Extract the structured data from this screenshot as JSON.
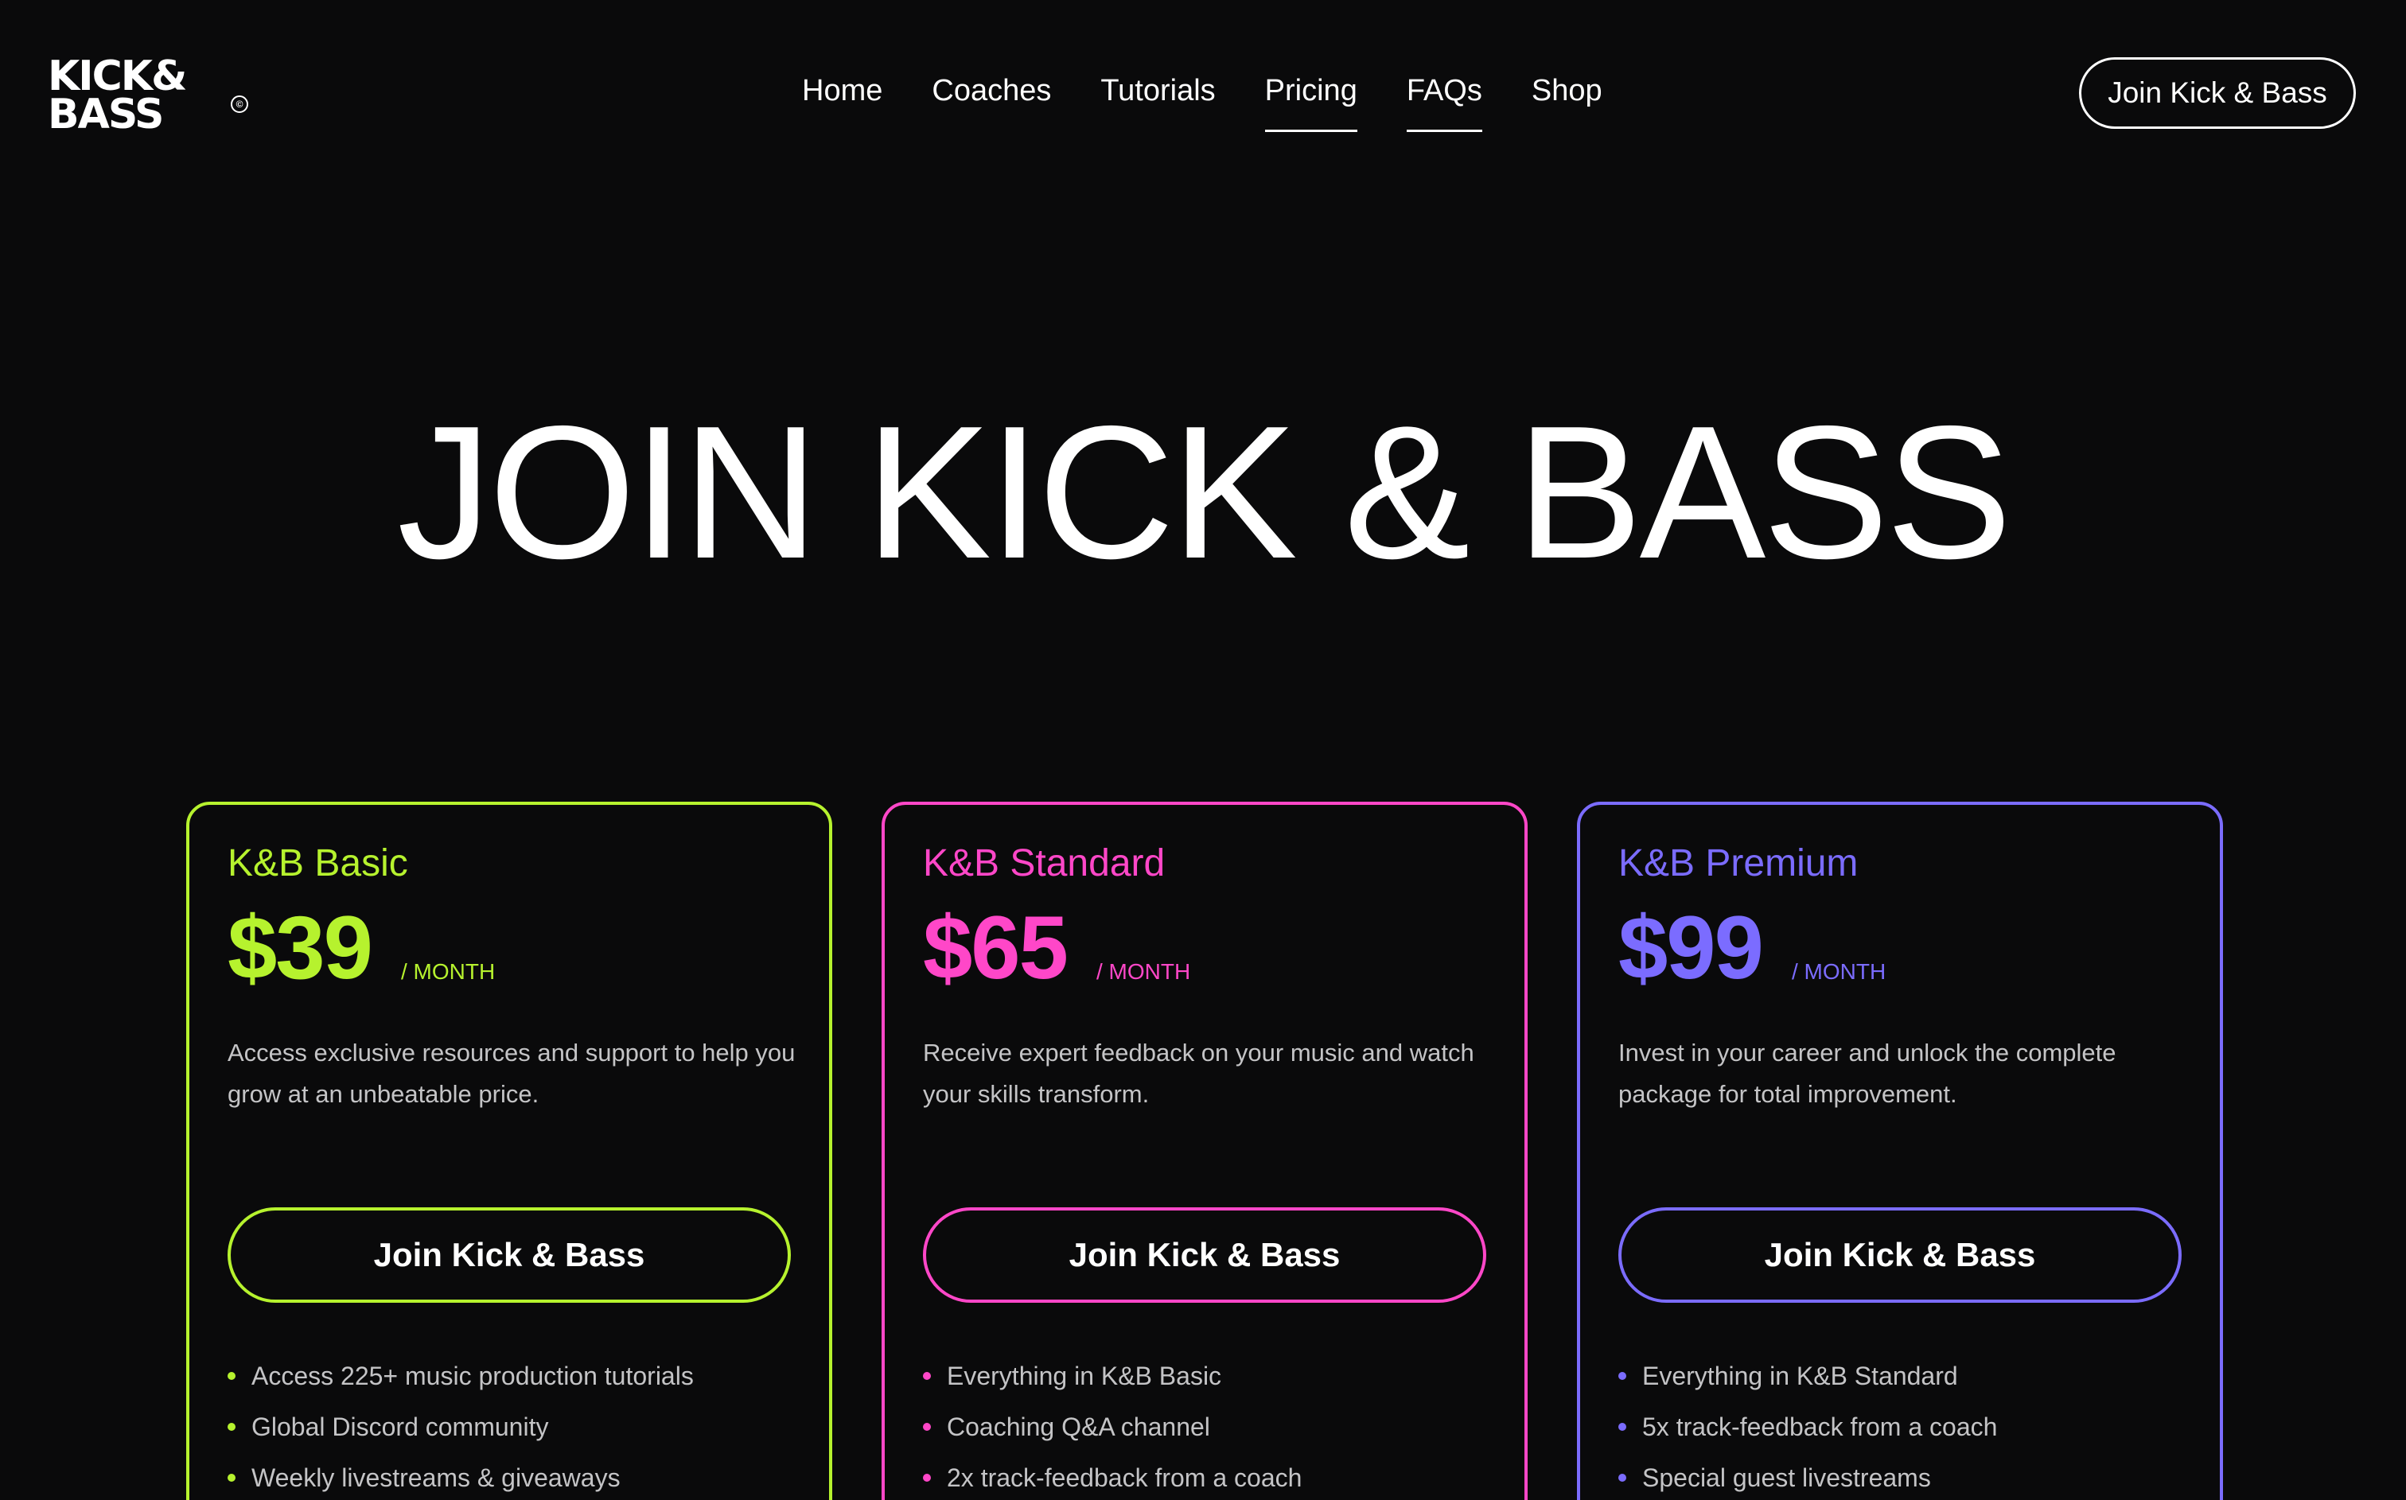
{
  "brand": {
    "logo_line1": "KICK&",
    "logo_line2": "BASS",
    "logo_mark": "©"
  },
  "nav": {
    "items": [
      {
        "label": "Home"
      },
      {
        "label": "Coaches"
      },
      {
        "label": "Tutorials"
      },
      {
        "label": "Pricing"
      },
      {
        "label": "FAQs"
      },
      {
        "label": "Shop"
      }
    ],
    "cta_label": "Join Kick & Bass"
  },
  "hero": {
    "title": "JOIN KICK & BASS"
  },
  "plans": [
    {
      "name": "K&B Basic",
      "price": "$39",
      "period": "/ MONTH",
      "description": "Access exclusive resources and support to help you grow at an unbeatable price.",
      "cta_label": "Join Kick & Bass",
      "accent": "#b6f22e",
      "features": [
        "Access 225+ music production tutorials",
        "Global Discord community",
        "Weekly livestreams & giveaways"
      ]
    },
    {
      "name": "K&B Standard",
      "price": "$65",
      "period": "/ MONTH",
      "description": "Receive expert feedback on your music and watch your skills transform.",
      "cta_label": "Join Kick & Bass",
      "accent": "#ff47c8",
      "features": [
        "Everything in K&B Basic",
        "Coaching Q&A channel",
        "2x track-feedback from a coach"
      ]
    },
    {
      "name": "K&B Premium",
      "price": "$99",
      "period": "/ MONTH",
      "description": "Invest in your career and unlock the complete package for total improvement.",
      "cta_label": "Join Kick & Bass",
      "accent": "#7b6cff",
      "features": [
        "Everything in K&B Standard",
        "5x track-feedback from a coach",
        "Special guest livestreams"
      ]
    }
  ],
  "colors": {
    "background": "#0a0a0b",
    "text": "#ffffff",
    "muted_text": "#c4c4c6"
  }
}
